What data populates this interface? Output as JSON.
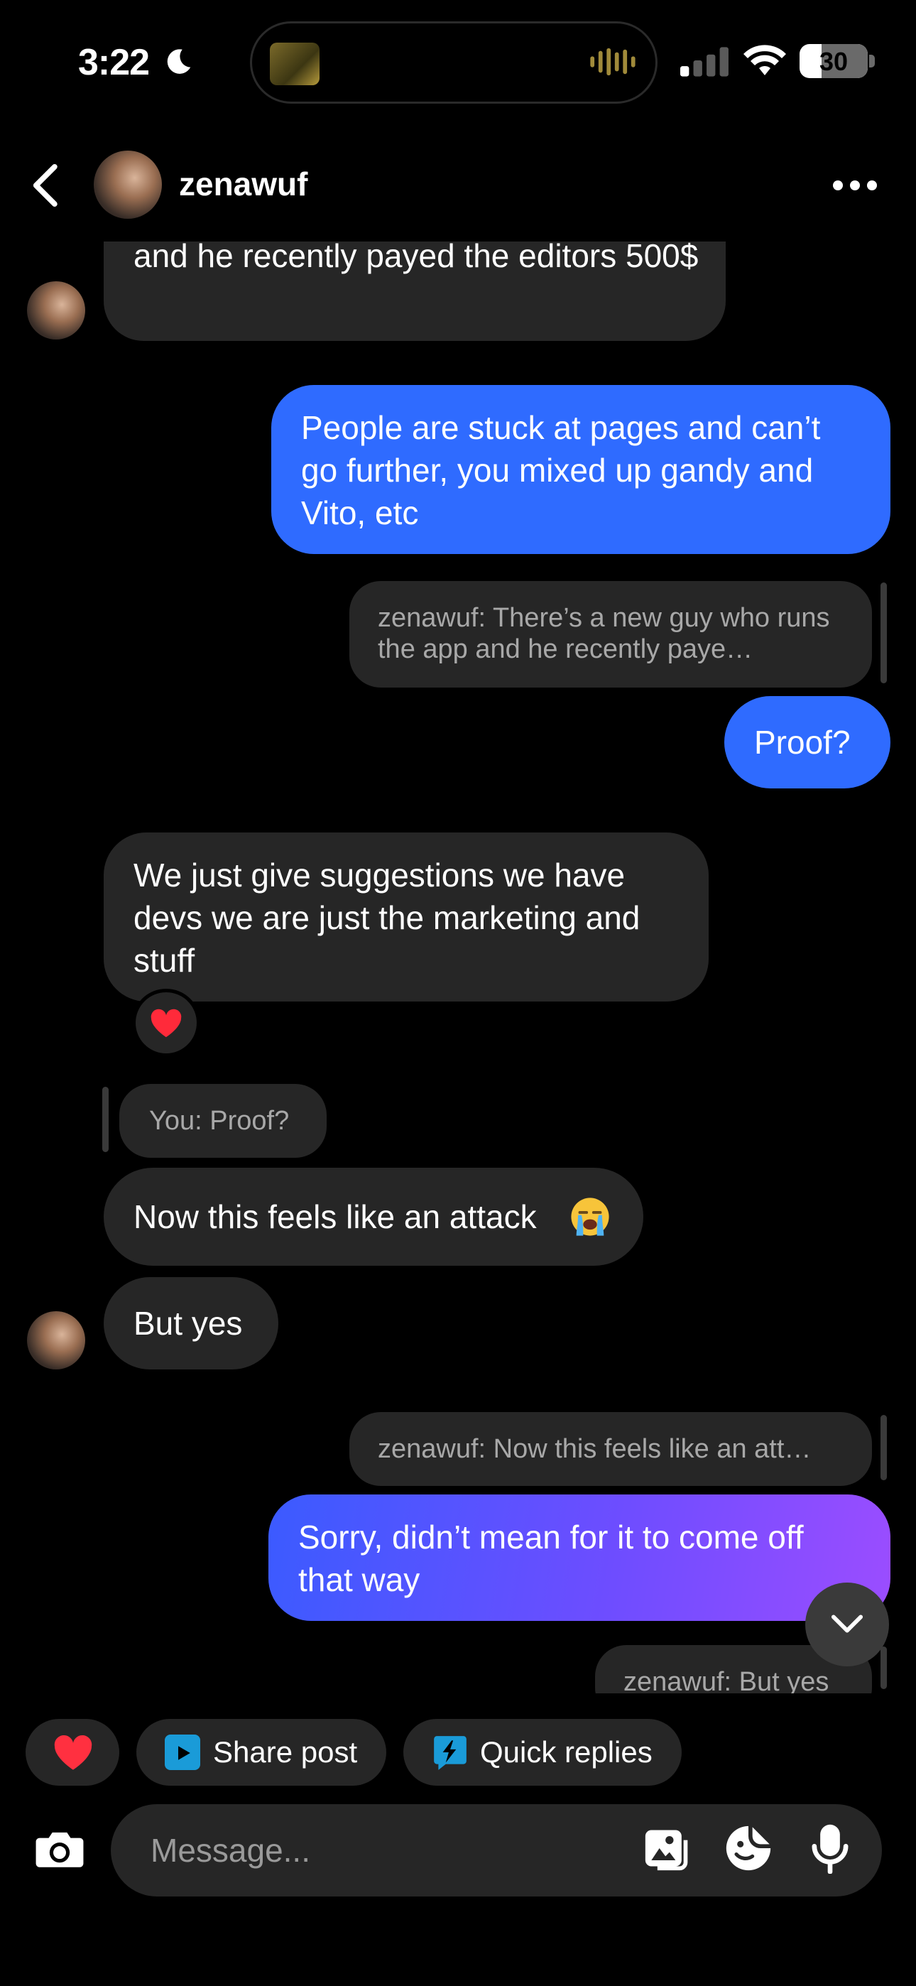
{
  "status_bar": {
    "time": "3:22",
    "battery": "30"
  },
  "header": {
    "contact_name": "zenawuf"
  },
  "messages": [
    {
      "text": "and he recently payed the editors 500$"
    },
    {
      "text": "People are stuck at pages and can’t go further, you mixed up gandy and Vito, etc"
    },
    {
      "reply_preview": "zenawuf: There’s a new guy who runs the app and he recently paye…"
    },
    {
      "text": "Proof?"
    },
    {
      "text": "We just give suggestions we have devs we are just the marketing and stuff",
      "reaction": "heart-icon"
    },
    {
      "reply_preview": "You: Proof?"
    },
    {
      "text": "Now this feels like an attack",
      "emoji": "loudly-crying-face-icon"
    },
    {
      "text": "But yes"
    },
    {
      "reply_preview": "zenawuf: Now this feels like an att…"
    },
    {
      "text": "Sorry, didn’t mean for it to come off that way"
    },
    {
      "reply_preview": "zenawuf: But yes"
    }
  ],
  "quick_actions": {
    "share_post": "Share post",
    "quick_replies": "Quick replies"
  },
  "composer": {
    "placeholder": "Message..."
  },
  "colors": {
    "outgoing": "#2f6bff",
    "incoming": "#262626",
    "accent_gradient_end": "#9b4dff",
    "heart": "#ff3040"
  }
}
